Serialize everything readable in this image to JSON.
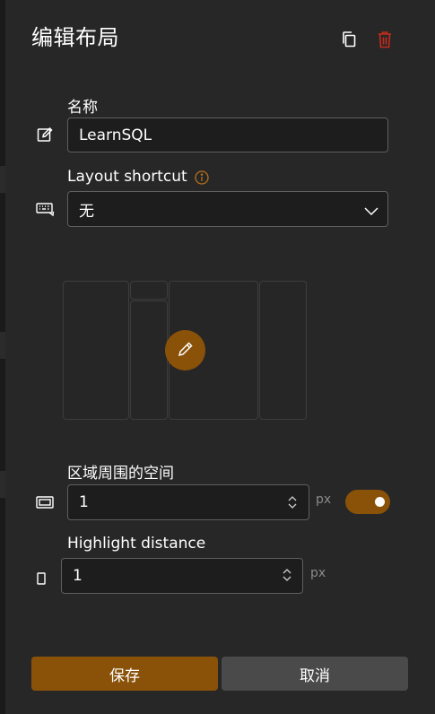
{
  "header": {
    "title": "编辑布局",
    "copy_icon": "copy-icon",
    "delete_icon": "trash-icon"
  },
  "name_field": {
    "label": "名称",
    "value": "LearnSQL",
    "icon": "rename-icon"
  },
  "shortcut_field": {
    "label": "Layout shortcut",
    "info_icon": "info-icon",
    "selected": "无",
    "icon": "keyboard-icon"
  },
  "layout_preview": {
    "edit_icon": "pencil-icon"
  },
  "spacing_field": {
    "label": "区域周围的空间",
    "value": "1",
    "unit": "px",
    "enabled": true,
    "icon": "spacing-icon"
  },
  "highlight_field": {
    "label": "Highlight distance",
    "value": "1",
    "unit": "px",
    "icon": "highlight-distance-icon"
  },
  "footer": {
    "save_label": "保存",
    "cancel_label": "取消"
  },
  "colors": {
    "accent": "#8a5208",
    "danger": "#c42b1c",
    "info": "#b8701a"
  }
}
